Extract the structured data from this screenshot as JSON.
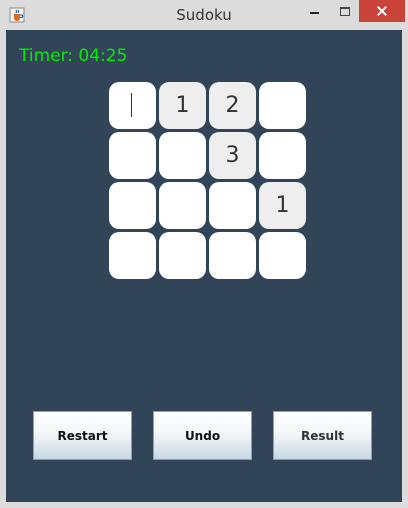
{
  "window": {
    "title": "Sudoku",
    "icon": "java-cup-icon"
  },
  "timer": {
    "text": "Timer: 04:25"
  },
  "board": {
    "rows": [
      [
        "",
        "1",
        "2",
        ""
      ],
      [
        "",
        "",
        "3",
        ""
      ],
      [
        "",
        "",
        "",
        "1"
      ],
      [
        "",
        "",
        "",
        ""
      ]
    ],
    "focused_cell": "row 1, column 1",
    "colors": {
      "background": "#324558",
      "cell_empty": "#ffffff",
      "cell_given": "#eeeeee",
      "timer": "#00ee00"
    }
  },
  "buttons": {
    "restart_label": "Restart",
    "undo_label": "Undo",
    "result_label": "Result"
  }
}
